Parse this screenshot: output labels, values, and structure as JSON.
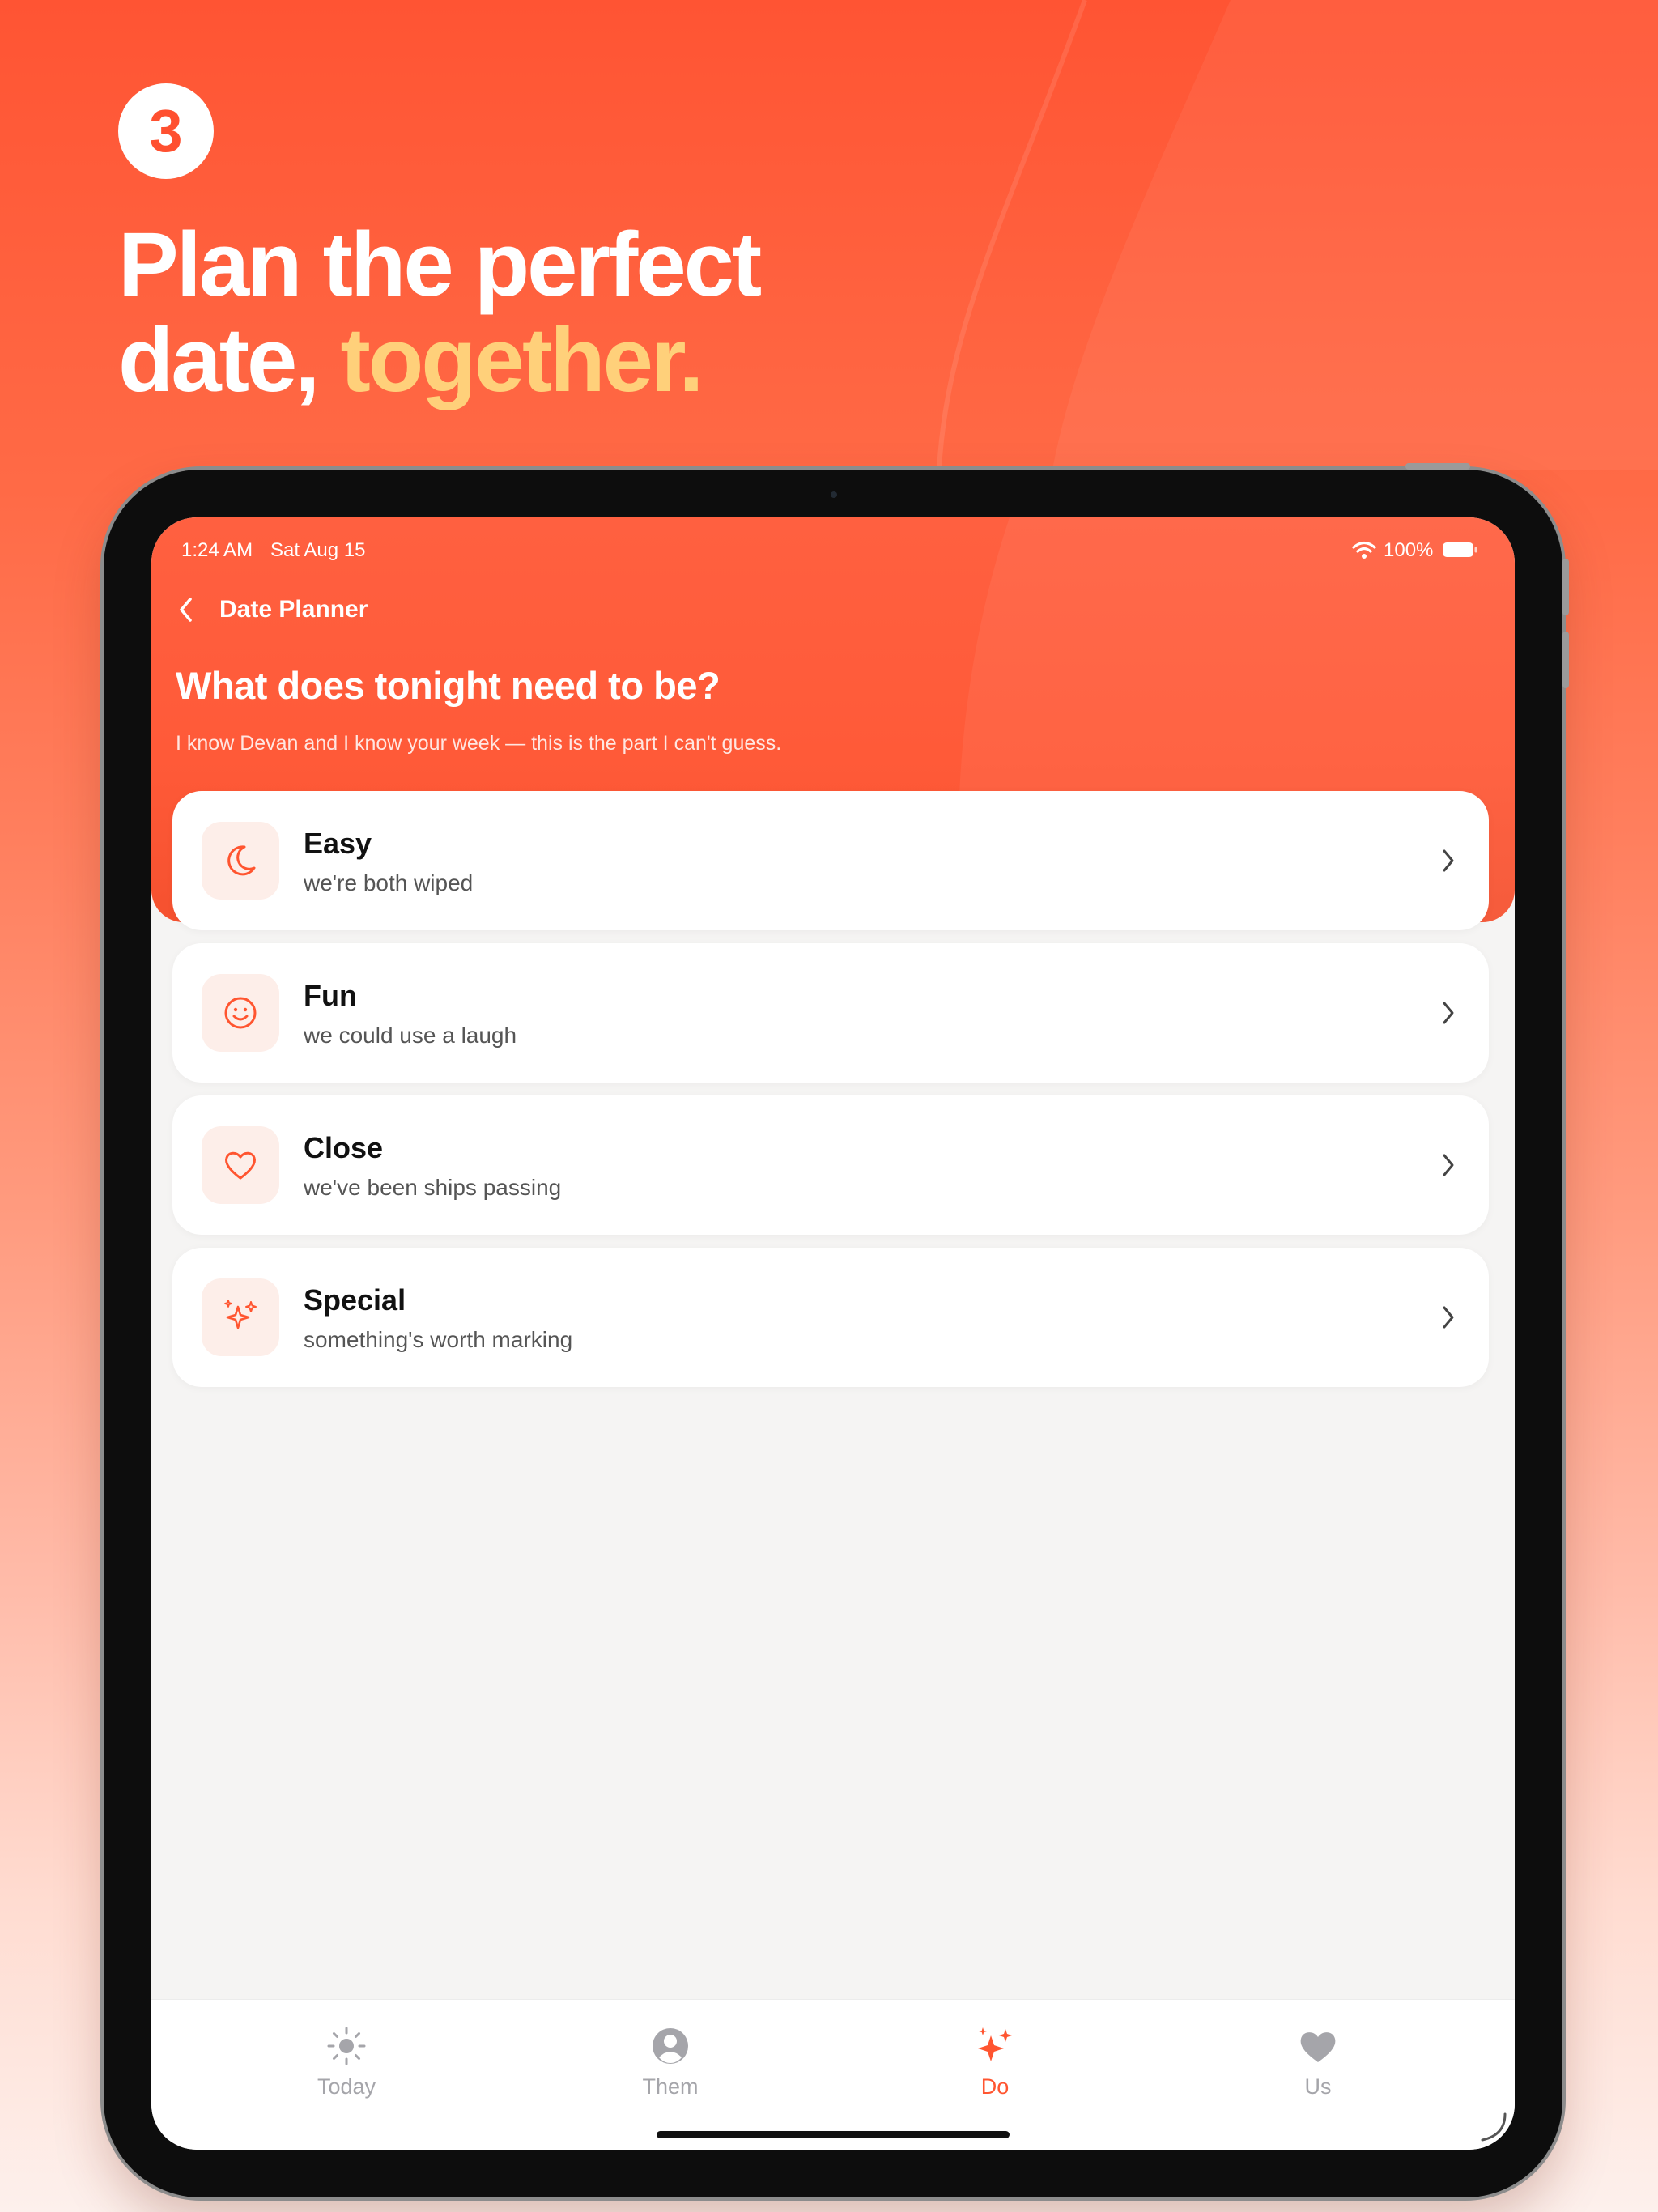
{
  "promo": {
    "step_number": "3",
    "headline_line1": "Plan the perfect",
    "headline_line2_start": "date, ",
    "headline_line2_accent": "together.",
    "accent_color": "#ffd07a"
  },
  "status_bar": {
    "time": "1:24 AM",
    "date": "Sat Aug 15",
    "battery": "100%"
  },
  "nav": {
    "back_label": "Date Planner"
  },
  "screen": {
    "question": "What does tonight need to be?",
    "subtitle": "I know Devan and I know your week — this is the part I can't guess."
  },
  "options": [
    {
      "title": "Easy",
      "subtitle": "we're both wiped",
      "icon": "moon-icon"
    },
    {
      "title": "Fun",
      "subtitle": "we could use a laugh",
      "icon": "smile-icon"
    },
    {
      "title": "Close",
      "subtitle": "we've been ships passing",
      "icon": "heart-outline-icon"
    },
    {
      "title": "Special",
      "subtitle": "something's worth marking",
      "icon": "sparkles-icon"
    }
  ],
  "tabs": [
    {
      "label": "Today",
      "icon": "sun-icon",
      "active": false
    },
    {
      "label": "Them",
      "icon": "person-icon",
      "active": false
    },
    {
      "label": "Do",
      "icon": "sparkles-icon",
      "active": true
    },
    {
      "label": "Us",
      "icon": "heart-icon",
      "active": false
    }
  ],
  "colors": {
    "brand": "#ff5530",
    "inactive_tab": "#a5a5aa",
    "icon_tile": "#fdeee9"
  }
}
